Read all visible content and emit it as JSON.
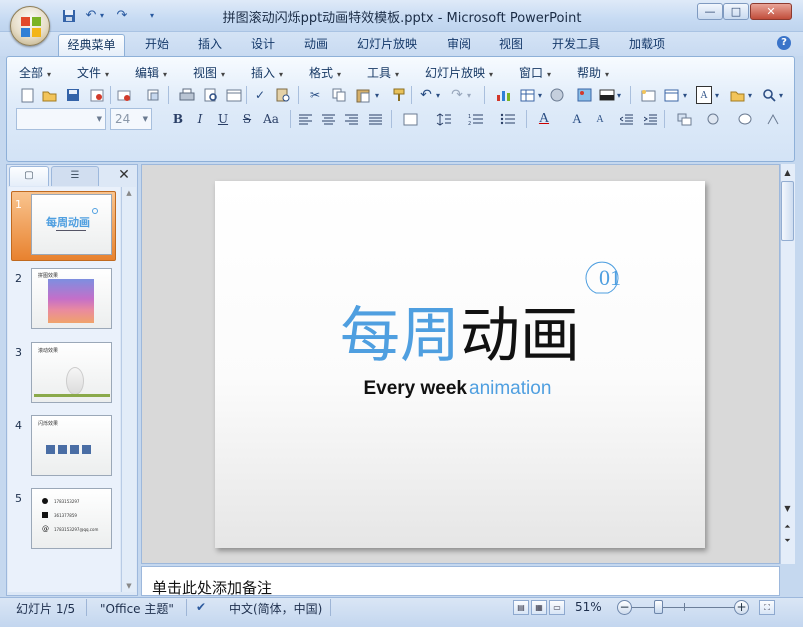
{
  "window": {
    "title": "拼图滚动闪烁ppt动画特效模板.pptx - Microsoft PowerPoint",
    "minimize": "—",
    "maximize": "□",
    "close": "✕"
  },
  "ribbon_tabs": [
    "经典菜单",
    "开始",
    "插入",
    "设计",
    "动画",
    "幻灯片放映",
    "审阅",
    "视图",
    "开发工具",
    "加载项"
  ],
  "menus": [
    "全部",
    "文件",
    "编辑",
    "视图",
    "插入",
    "格式",
    "工具",
    "幻灯片放映",
    "窗口",
    "帮助"
  ],
  "font": {
    "name": "",
    "size": "24"
  },
  "format_buttons": [
    "B",
    "I",
    "U",
    "S",
    "Aa"
  ],
  "left_pane": {
    "close": "✕",
    "slides": [
      {
        "num": "1",
        "title": "每周动画"
      },
      {
        "num": "2",
        "title": "拼图效果"
      },
      {
        "num": "3",
        "title": "滚动效果"
      },
      {
        "num": "4",
        "title": "闪烁效果"
      },
      {
        "num": "5",
        "lines": [
          "1783153297",
          "361377859",
          "1783153297@qq.com"
        ]
      }
    ]
  },
  "slide": {
    "badge": "01",
    "logo_blue": "每周",
    "logo_black": "动画",
    "subtitle_black": "Every week",
    "subtitle_blue": "animation"
  },
  "notes": {
    "placeholder": "单击此处添加备注"
  },
  "status": {
    "slide_info": "幻灯片 1/5",
    "theme": "\"Office 主题\"",
    "language": "中文(简体，中国)",
    "zoom": "51%",
    "zoom_level": 0.51
  },
  "colors": {
    "brand_blue": "#4f9fe0",
    "accent_orange": "#e8822f"
  },
  "icons": [
    "office-button-icon",
    "save-icon",
    "undo-icon",
    "redo-icon",
    "help-icon"
  ]
}
